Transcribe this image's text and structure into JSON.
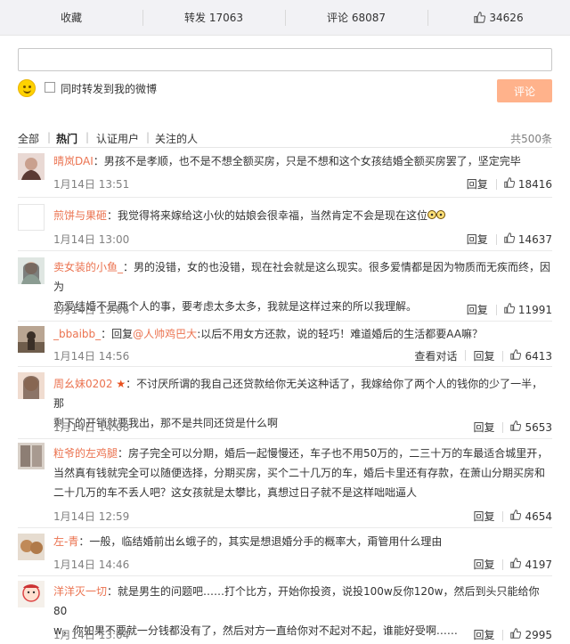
{
  "top_bar": {
    "collect_label": "收藏",
    "forward_label": "转发 17063",
    "comment_label": "评论 68087",
    "like_count": "34626"
  },
  "composer": {
    "input_value": "",
    "forward_checkbox_label": "同时转发到我的微博",
    "submit_label": "评论",
    "forward_checked": false
  },
  "filters": {
    "tabs": [
      "全部",
      "热门",
      "认证用户",
      "关注的人"
    ],
    "active_tab": "热门",
    "total": "共500条"
  },
  "comments": [
    {
      "user": "晴岚DAI",
      "text": "：男孩不是孝顺，也不是不想全额买房，只是不想和这个女孩结婚全额买房罢了，坚定完毕",
      "time": "1月14日 13:51",
      "reply_label": "回复",
      "likes": "18416"
    },
    {
      "user": "煎饼与果砸",
      "text": "：我觉得将来嫁给这小伙的姑娘会很幸福，当然肯定不会是现在这位",
      "time": "1月14日 13:00",
      "reply_label": "回复",
      "likes": "14637"
    },
    {
      "user": "卖女装的小鱼_",
      "line1": "：男的没错，女的也没错，现在社会就是这么现实。很多爱情都是因为物质而无疾而终，因为",
      "line2": "恋爱结婚不是两个人的事，要考虑太多太多，我就是这样过来的所以我理解。",
      "time": "1月14日 13:06",
      "reply_label": "回复",
      "likes": "11991"
    },
    {
      "user": "_bbaibb_",
      "prefix": "：回复",
      "mention": "@人帅鸡巴大",
      "text": ":以后不用女方还款，说的轻巧！难道婚后的生活都要AA嘛？",
      "time": "1月14日 14:56",
      "view_conversation": "查看对话",
      "reply_label": "回复",
      "likes": "6413"
    },
    {
      "user": "周幺妹0202",
      "line1": "：不讨厌所谓的我自己还贷款给你无关这种话了，我嫁给你了两个人的钱你的少了一半，那",
      "line2": "剩下的开销就要我出，那不是共同还贷是什么啊",
      "time": "1月14日 14:08",
      "reply_label": "回复",
      "likes": "5653"
    },
    {
      "user": "粒爷的左鸡腿",
      "line1": "：房子完全可以分期，婚后一起慢慢还，车子也不用50万的，二三十万的车最适合城里开，",
      "line2": "当然真有钱就完全可以随便选择，分期买房，买个二十几万的车，婚后卡里还有存款，在萧山分期买房和",
      "line3": "二十几万的车不丢人吧？这女孩就是太攀比，真想过日子就不是这样咄咄逼人",
      "time": "1月14日 12:59",
      "reply_label": "回复",
      "likes": "4654"
    },
    {
      "user": "左-青",
      "text": "：一般，临结婚前出幺蛾子的，其实是想退婚分手的概率大，甭管用什么理由",
      "time": "1月14日 14:46",
      "reply_label": "回复",
      "likes": "4197"
    },
    {
      "user": "洋洋灭一切",
      "line1": "：就是男生的问题吧……打个比方，开始你投资，说投100w反你120w，然后到头只能给你80",
      "line2": "w，你如果不要就一分钱都没有了，然后对方一直给你对不起对不起，谁能好受啊……",
      "time": "1月14日 13:04",
      "reply_label": "回复",
      "likes": "2995"
    }
  ],
  "colors": {
    "link": "#eb7350",
    "submit_disabled": "#ffb28b",
    "star": "#e8501e"
  }
}
